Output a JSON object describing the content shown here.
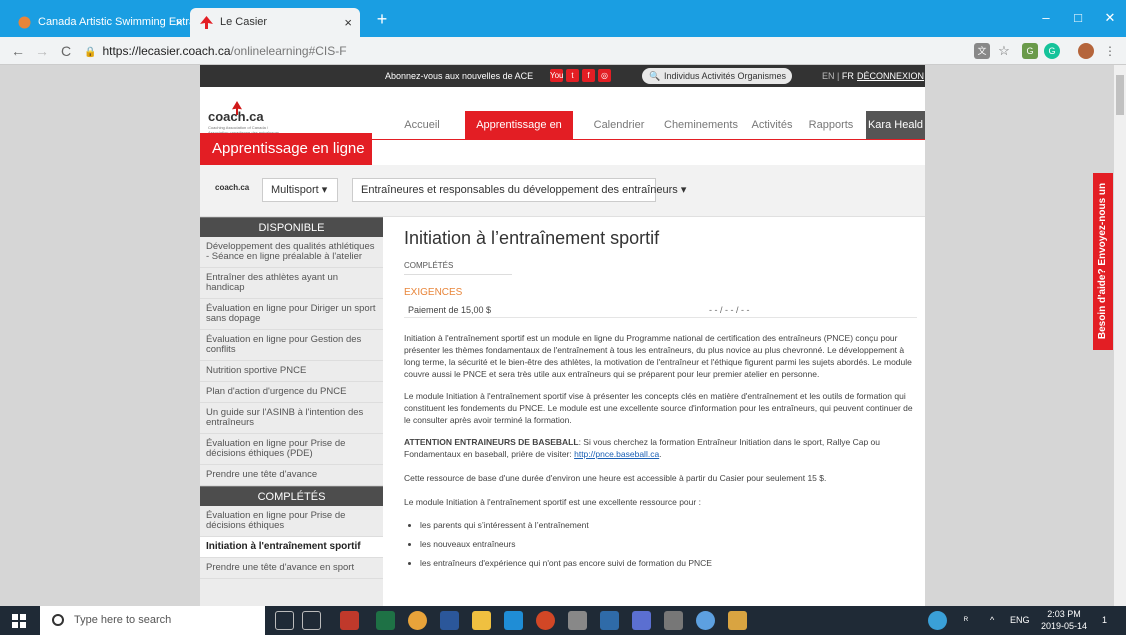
{
  "browser": {
    "tabs": [
      {
        "title": "Canada Artistic Swimming Entra",
        "close": "×"
      },
      {
        "title": "Le Casier",
        "close": "×"
      }
    ],
    "new_tab": "+",
    "window_controls": {
      "minimize": "–",
      "maximize": "□",
      "close": "✕"
    },
    "nav": {
      "back": "←",
      "forward": "→",
      "reload": "C"
    },
    "url": {
      "host": "https://lecasier.coach.ca",
      "path": "/onlinelearning#CIS-F"
    },
    "toolbar_icons": [
      "translate-icon",
      "star-icon",
      "extension-icon",
      "grammarly-icon",
      "profile-avatar",
      "menu-icon"
    ]
  },
  "site": {
    "top_strip": {
      "newsletter": "Abonnez-vous aux nouvelles de ACE",
      "social": [
        {
          "name": "youtube",
          "text": "You",
          "color": "#e31e24"
        },
        {
          "name": "twitter",
          "text": "t",
          "color": "#e31e24"
        },
        {
          "name": "facebook",
          "text": "f",
          "color": "#e31e24"
        },
        {
          "name": "instagram",
          "text": "◎",
          "color": "#e31e24"
        }
      ],
      "search": {
        "links": "Individus  Activités  Organismes"
      },
      "lang_en": "EN",
      "lang_sep": "|",
      "lang_fr": "FR",
      "logout": "DÉCONNEXION"
    },
    "logo": {
      "word": "coach.ca",
      "tagline": "Coaching Association of Canada / Association canadienne des entraîneurs"
    },
    "nav": [
      {
        "label": "Accueil"
      },
      {
        "label": "Apprentissage en ligne"
      },
      {
        "label": "Calendrier"
      },
      {
        "label": "Cheminements"
      },
      {
        "label": "Activités"
      },
      {
        "label": "Rapports"
      },
      {
        "label": "Kara Heald"
      }
    ],
    "section_title": "Apprentissage en ligne",
    "filters": {
      "logo": "coach.ca",
      "sport": "Multisport  ▾",
      "audience": "Entraîneures et responsables du développement des entraîneurs  ▾"
    },
    "sidebar": {
      "available_header": "DISPONIBLE",
      "available": [
        "Développement des qualités athlétiques - Séance en ligne préalable à l'atelier",
        "Entraîner des athlètes ayant un handicap",
        "Évaluation en ligne pour Diriger un sport sans dopage",
        "Évaluation en ligne pour Gestion des conflits",
        "Nutrition sportive PNCE",
        "Plan d'action d'urgence du PNCE",
        "Un guide sur l'ASINB à l'intention des entraîneurs",
        "Évaluation en ligne pour Prise de décisions éthiques (PDE)",
        "Prendre une tête d'avance"
      ],
      "completed_header": "COMPLÉTÉS",
      "completed": [
        "Évaluation en ligne pour Prise de décisions éthiques",
        "Initiation à l'entraînement sportif",
        "Prendre une tête d'avance en sport"
      ]
    },
    "content": {
      "title": "Initiation à l’entraînement sportif",
      "status": "COMPLÉTÉS",
      "requirements_header": "EXIGENCES",
      "payment": "Paiement de 15,00 $",
      "payment_date": "- - / - - / - -",
      "p1": "Initiation à l'entraînement sportif est un module en ligne du Programme national de certification des entraîneurs (PNCE) conçu pour présenter les thèmes fondamentaux de l'entraînement à tous les entraîneurs, du plus novice au plus chevronné. Le développement à long terme, la sécurité et le bien-être des athlètes, la motivation de l'entraîneur et l'éthique figurent parmi les sujets abordés. Le module couvre aussi le PNCE et sera très utile aux entraîneurs qui se préparent pour leur premier atelier en personne.",
      "p2": "Le module Initiation à l'entraînement sportif vise à présenter les concepts clés en matière d'entraînement et les outils de formation qui constituent les fondements du PNCE. Le module est une excellente source d'information pour les entraîneurs, qui peuvent continuer de le consulter après avoir terminé la formation.",
      "p3_bold": "ATTENTION ENTRAINEURS DE BASEBALL",
      "p3_text": ": Si vous cherchez la formation Entraîneur Initiation dans le sport, Rallye Cap ou Fondamentaux en baseball, prière de visiter: ",
      "p3_link": "http://pnce.baseball.ca",
      "p3_end": ".",
      "p4": "Cette ressource de base d'une durée d'environ une heure est accessible à partir du Casier pour seulement 15 $.",
      "p5": "Le module Initiation à l'entraînement sportif est une excellente ressource pour :",
      "bullets": [
        "les parents qui s’intéressent à l’entraînement",
        "les nouveaux entraîneurs",
        "les entraîneurs d'expérience qui n'ont pas encore suivi de formation du PNCE"
      ]
    },
    "help_tab": "Besoin d'aide? Envoyez-nous un"
  },
  "taskbar": {
    "search_placeholder": "Type here to search",
    "lang": "ENG",
    "time": "2:03 PM",
    "date": "2019-05-14",
    "notifications": "1"
  }
}
